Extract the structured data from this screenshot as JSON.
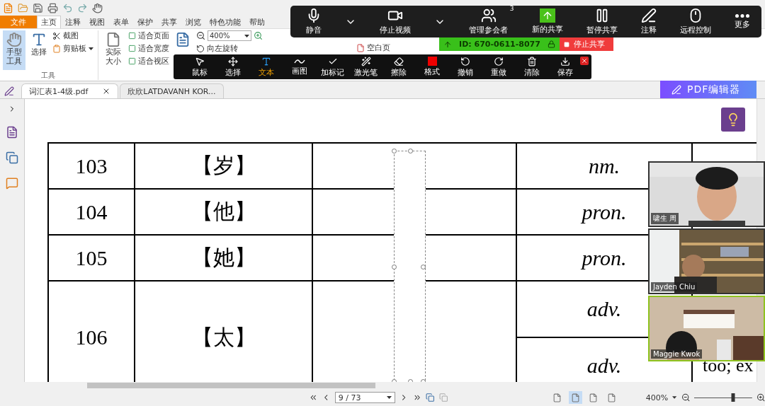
{
  "menu_tabs": [
    {
      "label": "文件",
      "kind": "file",
      "selected": false
    },
    {
      "label": "主页",
      "kind": "tab",
      "selected": true
    },
    {
      "label": "注释",
      "kind": "tab",
      "selected": false
    },
    {
      "label": "视图",
      "kind": "tab",
      "selected": false
    },
    {
      "label": "表单",
      "kind": "tab",
      "selected": false
    },
    {
      "label": "保护",
      "kind": "tab",
      "selected": false
    },
    {
      "label": "共享",
      "kind": "tab",
      "selected": false
    },
    {
      "label": "浏览",
      "kind": "tab",
      "selected": false
    },
    {
      "label": "特色功能",
      "kind": "tab",
      "selected": false
    },
    {
      "label": "帮助",
      "kind": "tab",
      "selected": false
    }
  ],
  "ribbon": {
    "hand_tool": {
      "label": "手型工具",
      "selected": true
    },
    "select_tool": "选择",
    "small_tools": [
      "截图",
      "剪贴板"
    ],
    "group_label": "工具",
    "actual_size": "实际大小",
    "fit_options": [
      "适合页面",
      "适合宽度",
      "适合视区"
    ],
    "zoom_value": "400%",
    "rotate_left": "向左旋转",
    "blank_page": "空白页"
  },
  "doc_tabs": [
    {
      "label": "词汇表1-4级.pdf",
      "selected": true
    },
    {
      "label": "欣欣LATDAVANH KOR...",
      "selected": false
    }
  ],
  "pdf_editor_button": "PDF编辑器",
  "table": {
    "rows": [
      {
        "number": "103",
        "word": "【岁】",
        "senses": [
          {
            "pos": "nm."
          }
        ]
      },
      {
        "number": "104",
        "word": "【他】",
        "senses": [
          {
            "pos": "pron."
          }
        ]
      },
      {
        "number": "105",
        "word": "【她】",
        "senses": [
          {
            "pos": "pron."
          }
        ]
      },
      {
        "number": "106",
        "word": "【太】",
        "senses": [
          {
            "pos": "adv."
          },
          {
            "pos": "adv.",
            "gloss": "too; ex"
          }
        ]
      }
    ]
  },
  "meeting_toolbar": {
    "buttons": [
      {
        "label": "静音",
        "kind": "mic",
        "menu": true
      },
      {
        "label": "停止视频",
        "kind": "video",
        "menu": true
      },
      {
        "label": "管理参会者",
        "kind": "participants",
        "count": "3"
      },
      {
        "label": "新的共享",
        "kind": "share"
      },
      {
        "label": "暂停共享",
        "kind": "pause"
      },
      {
        "label": "注释",
        "kind": "annotate"
      },
      {
        "label": "远程控制",
        "kind": "remote"
      },
      {
        "label": "更多",
        "kind": "more"
      }
    ],
    "meeting_id": "ID: 670-0611-8077",
    "stop_share": "停止共享"
  },
  "annotation_toolbar": {
    "tools": [
      {
        "label": "鼠标",
        "selected": false
      },
      {
        "label": "选择",
        "selected": false
      },
      {
        "label": "文本",
        "selected": true
      },
      {
        "label": "画图",
        "selected": false
      },
      {
        "label": "加标记",
        "selected": false
      },
      {
        "label": "激光笔",
        "selected": false
      },
      {
        "label": "擦除",
        "selected": false
      },
      {
        "label": "格式",
        "selected": false
      },
      {
        "label": "撤销",
        "selected": false
      },
      {
        "label": "重做",
        "selected": false
      },
      {
        "label": "清除",
        "selected": false
      },
      {
        "label": "保存",
        "selected": false
      }
    ]
  },
  "video_tiles": [
    {
      "name": "啸生 周",
      "active_speaker": false
    },
    {
      "name": "Jayden Chiu",
      "active_speaker": false
    },
    {
      "name": "Maggie Kwok",
      "active_speaker": true
    }
  ],
  "status_bar": {
    "page": "9 / 73",
    "zoom": "400%",
    "zoom_slider": {
      "level": 0.68
    },
    "view_modes": [
      {
        "selected": false
      },
      {
        "selected": true
      },
      {
        "selected": false
      },
      {
        "selected": false
      }
    ]
  }
}
